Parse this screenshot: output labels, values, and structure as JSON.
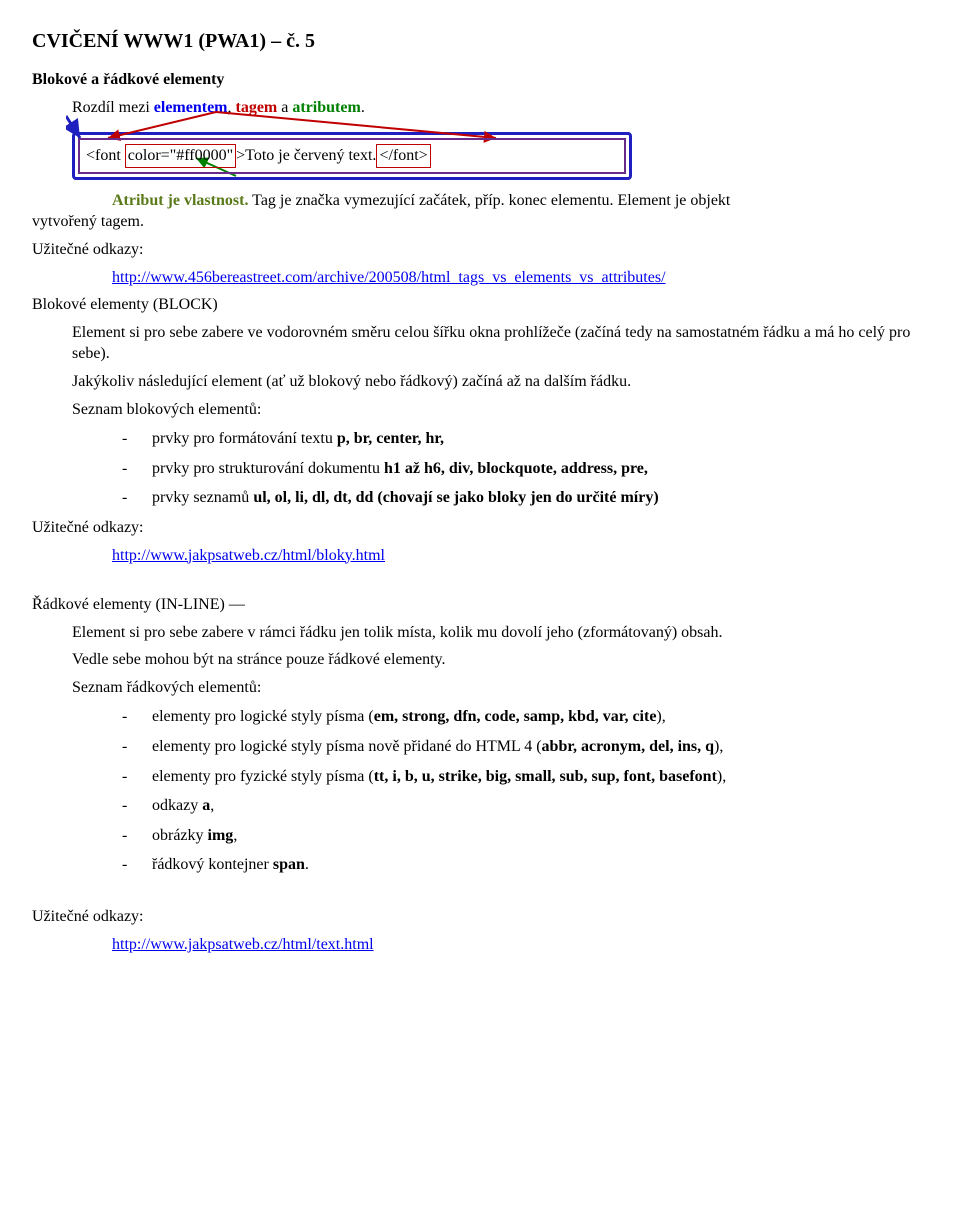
{
  "title": "CVIČENÍ WWW1 (PWA1) – č. 5",
  "h2": "Blokové a řádkové elementy",
  "intro_pre": "Rozdíl mezi ",
  "intro_elementem": "elementem",
  "intro_sep1": ", ",
  "intro_tagem": "tagem",
  "intro_sep2": " a ",
  "intro_atributem": "atributem",
  "intro_end": ".",
  "code": {
    "lt1": "<font ",
    "attr": "color=\"#ff0000\"",
    "gt1": ">",
    "text": "Toto je červený text.",
    "close": "</font>"
  },
  "p_attr": "Atribut je vlastnost. Tag je značka vymezující začátek, příp. konec elementu. Element je objekt vytvořený tagem.",
  "useful": "Užitečné odkazy:",
  "link1": "http://www.456bereastreet.com/archive/200508/html_tags_vs_elements_vs_attributes/",
  "block_head": "Blokové elementy (BLOCK) ",
  "block_p1": "Element si pro sebe zabere ve vodorovném směru celou šířku okna prohlížeče (začíná tedy na samostatném řádku a má ho celý pro sebe).",
  "block_p2": "Jakýkoliv následující element (ať už blokový nebo řádkový) začíná až na dalším řádku.",
  "block_p3": "Seznam blokových elementů:",
  "block_items": [
    {
      "pre": "prvky pro formátování textu ",
      "bold": "p, br, center, hr,"
    },
    {
      "pre": "prvky pro strukturování dokumentu ",
      "bold": "h1 až h6, div, blockquote, address, pre,"
    },
    {
      "pre": "prvky seznamů ",
      "bold": "ul, ol, li, dl, dt, dd (chovají se jako bloky jen do určité míry)"
    }
  ],
  "link2": "http://www.jakpsatweb.cz/html/bloky.html",
  "inline_head": "Řádkové elementy (IN-LINE) ––",
  "inline_p1": "Element si pro sebe zabere v rámci řádku jen tolik místa, kolik mu dovolí jeho (zformátovaný) obsah.",
  "inline_p2": "Vedle sebe mohou být na stránce pouze řádkové elementy.",
  "inline_p3": "Seznam řádkových elementů:",
  "inline_items": [
    {
      "pre": "elementy pro logické styly písma (",
      "bold": "em, strong, dfn, code, samp, kbd, var, cite",
      "post": "),"
    },
    {
      "pre": "elementy pro logické styly písma nově přidané do HTML 4 (",
      "bold": "abbr, acronym, del, ins, q",
      "post": "),"
    },
    {
      "pre": "elementy pro fyzické styly písma (",
      "bold": "tt, i, b, u, strike, big, small, sub, sup, font, basefont",
      "post": "),"
    },
    {
      "pre": "odkazy ",
      "bold": "a",
      "post": ","
    },
    {
      "pre": "obrázky ",
      "bold": "img",
      "post": ","
    },
    {
      "pre": "řádkový kontejner ",
      "bold": "span",
      "post": "."
    }
  ],
  "link3": "http://www.jakpsatweb.cz/html/text.html"
}
